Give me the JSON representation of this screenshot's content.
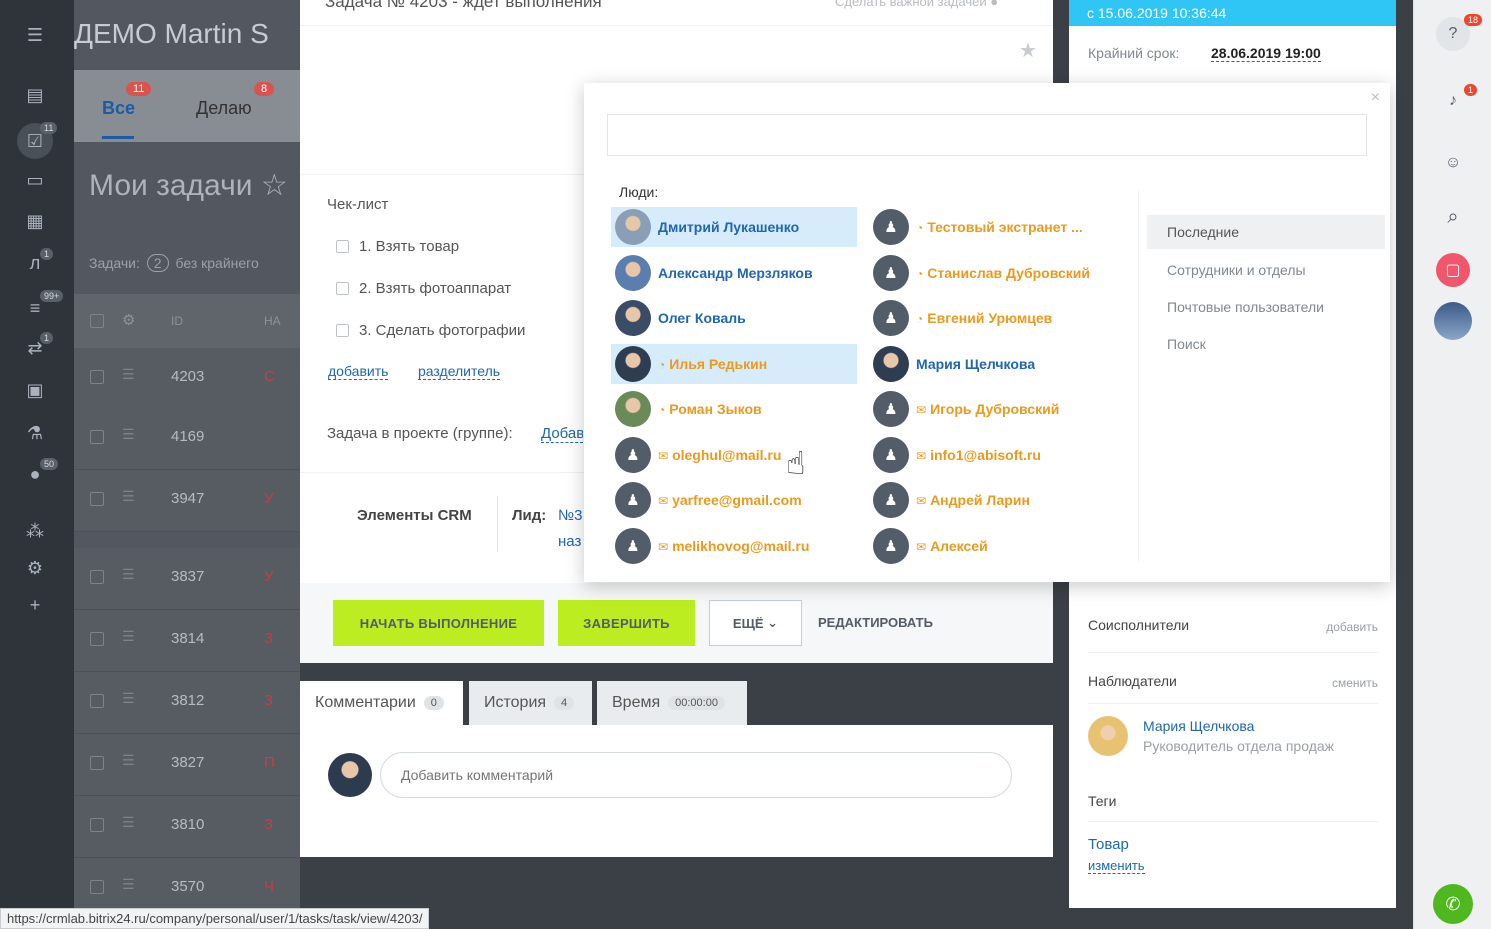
{
  "portal": {
    "title": "ДЕМО Martin S",
    "close_icon": "×"
  },
  "left_sidebar": {
    "badges": {
      "tasks": "11",
      "counter_l": "1",
      "filter": "99+",
      "sync": "1",
      "flag": "50"
    }
  },
  "list_panel": {
    "tabs": [
      {
        "label": "Все",
        "badge": "11"
      },
      {
        "label": "Делаю",
        "badge": "8"
      }
    ],
    "heading": "Мои задачи",
    "heading_star": "☆",
    "filter_prefix": "Задачи:",
    "filter_count": "2",
    "filter_suffix": "без крайнего",
    "columns": {
      "id": "ID",
      "name": "НА"
    },
    "rows": [
      {
        "id": "4203",
        "letter": "С"
      },
      {
        "id": "4169",
        "letter": ""
      },
      {
        "id": "3947",
        "letter": "У"
      },
      {
        "id": "3837",
        "letter": "У"
      },
      {
        "id": "3814",
        "letter": "З"
      },
      {
        "id": "3812",
        "letter": "З"
      },
      {
        "id": "3827",
        "letter": "П"
      },
      {
        "id": "3810",
        "letter": "З"
      },
      {
        "id": "3570",
        "letter": "Ч"
      }
    ]
  },
  "task": {
    "title": "Задача № 4203 - ждет выполнения",
    "make_important": "Сделать важной задачей",
    "checklist": {
      "title": "Чек-лист",
      "items": [
        "1. Взять товар",
        "2. Взять фотоаппарат",
        "3. Сделать фотографии"
      ],
      "add": "добавить",
      "separator": "разделитель"
    },
    "project_label": "Задача в проекте (группе):",
    "project_add": "Добавить",
    "crm": {
      "title": "Элементы CRM",
      "lead_label": "Лид:",
      "lead_link": "№3",
      "lead_sub": "наз"
    },
    "actions": {
      "start": "НАЧАТЬ ВЫПОЛНЕНИЕ",
      "finish": "ЗАВЕРШИТЬ",
      "more": "ЕЩЁ",
      "edit": "РЕДАКТИРОВАТЬ"
    },
    "comment_tabs": [
      {
        "label": "Комментарии",
        "count": "0"
      },
      {
        "label": "История",
        "count": "4"
      },
      {
        "label": "Время",
        "count": "00:00:00"
      }
    ],
    "comment_placeholder": "Добавить комментарий"
  },
  "info": {
    "header": "с 15.06.2019 10:36:44",
    "deadline_label": "Крайний срок:",
    "deadline_value": "28.06.2019 19:00",
    "coexecutors": "Соисполнители",
    "coexecutors_action": "добавить",
    "observers": "Наблюдатели",
    "observers_action": "сменить",
    "observer": {
      "name": "Мария Щелчкова",
      "position": "Руководитель отдела продаж"
    },
    "tags": "Теги",
    "tag_value": "Товар",
    "tag_change": "изменить"
  },
  "right_bar": {
    "help_badge": "18",
    "bell_badge": "1"
  },
  "popup": {
    "close": "×",
    "people_label": "Люди:",
    "people_col1": [
      {
        "name": "Дмитрий Лукашенко",
        "kind": "emp",
        "tag": "",
        "selected": true
      },
      {
        "name": "Александр Мерзляков",
        "kind": "emp",
        "tag": "",
        "selected": false
      },
      {
        "name": "Олег Коваль",
        "kind": "emp",
        "tag": "",
        "selected": false
      },
      {
        "name": "Илья Редькин",
        "kind": "ext",
        "tag": "◔",
        "selected": true
      },
      {
        "name": "Роман Зыков",
        "kind": "ext",
        "tag": "◔",
        "selected": false
      },
      {
        "name": "oleghul@mail.ru",
        "kind": "ext",
        "tag": "✉",
        "selected": false
      },
      {
        "name": "yarfree@gmail.com",
        "kind": "ext",
        "tag": "✉",
        "selected": false
      },
      {
        "name": "melikhovog@mail.ru",
        "kind": "ext",
        "tag": "✉",
        "selected": false
      }
    ],
    "people_col2": [
      {
        "name": "Тестовый экстранет ...",
        "kind": "ext",
        "tag": "◔",
        "selected": false
      },
      {
        "name": "Станислав Дубровский",
        "kind": "ext",
        "tag": "◔",
        "selected": false
      },
      {
        "name": "Евгений Урюмцев",
        "kind": "ext",
        "tag": "◔",
        "selected": false
      },
      {
        "name": "Мария Щелчкова",
        "kind": "emp",
        "tag": "",
        "selected": false
      },
      {
        "name": "Игорь Дубровский",
        "kind": "ext",
        "tag": "✉",
        "selected": false
      },
      {
        "name": "info1@abisoft.ru",
        "kind": "ext",
        "tag": "✉",
        "selected": false
      },
      {
        "name": "Андрей Ларин",
        "kind": "ext",
        "tag": "✉",
        "selected": false
      },
      {
        "name": "Алексей",
        "kind": "ext",
        "tag": "✉",
        "selected": false
      }
    ],
    "categories": [
      "Последние",
      "Сотрудники и отделы",
      "Почтовые пользователи",
      "Поиск"
    ]
  },
  "status_url": "https://crmlab.bitrix24.ru/company/personal/user/1/tasks/task/view/4203/",
  "icons": {
    "menu": "menu-icon",
    "feed": "feed-icon",
    "tasks": "tasks-icon",
    "chat": "chat-icon",
    "calendar": "calendar-icon",
    "star": "star-icon",
    "help": "help-icon",
    "bell": "bell-icon",
    "search": "search-icon",
    "lock": "lock-icon",
    "phone": "phone-icon",
    "cursor": "hand-cursor-icon"
  }
}
